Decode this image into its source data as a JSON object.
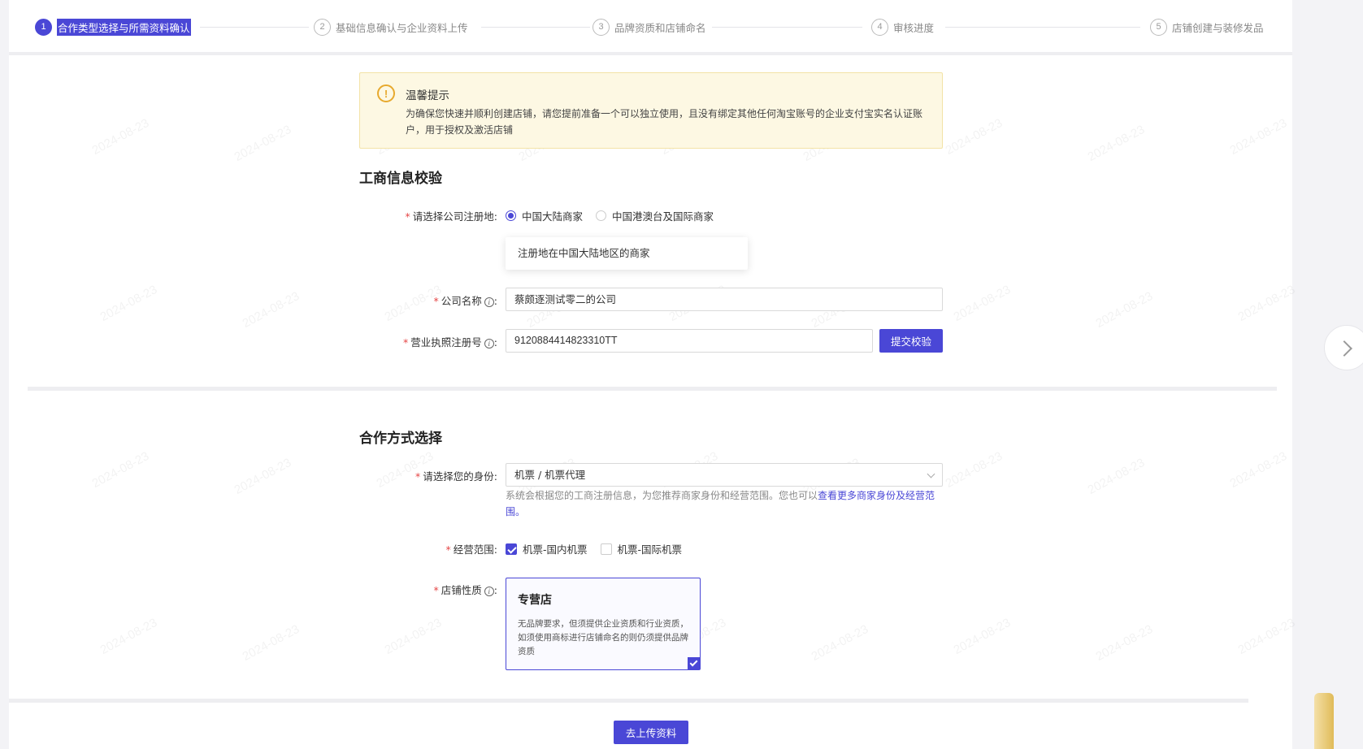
{
  "steps": [
    {
      "num": "1",
      "label": "合作类型选择与所需资料确认",
      "active": true
    },
    {
      "num": "2",
      "label": "基础信息确认与企业资料上传"
    },
    {
      "num": "3",
      "label": "品牌资质和店铺命名"
    },
    {
      "num": "4",
      "label": "审核进度"
    },
    {
      "num": "5",
      "label": "店铺创建与装修发品"
    }
  ],
  "notice": {
    "icon": "warning-icon",
    "title": "温馨提示",
    "text": "为确保您快速并顺利创建店铺，请您提前准备一个可以独立使用，且没有绑定其他任何淘宝账号的企业支付宝实名认证账户，用于授权及激活店铺"
  },
  "business_check": {
    "title": "工商信息校验",
    "region_label": "请选择公司注册地:",
    "region_options": [
      "中国大陆商家",
      "中国港澳台及国际商家"
    ],
    "region_selected": "中国大陆商家",
    "region_tooltip": "注册地在中国大陆地区的商家",
    "company_label": "公司名称",
    "company_value": "蔡颇逐测试零二的公司",
    "license_label": "营业执照注册号",
    "license_value": "9120884414823310TT",
    "submit_label": "提交校验"
  },
  "cooperation": {
    "title": "合作方式选择",
    "identity_label": "请选择您的身份:",
    "identity_value": "机票 / 机票代理",
    "help_text": "系统会根据您的工商注册信息，为您推荐商家身份和经营范围。您也可以",
    "help_link": "查看更多商家身份及经营范围",
    "help_end": "。",
    "scope_label": "经营范围:",
    "scope_options": [
      {
        "label": "机票-国内机票",
        "checked": true
      },
      {
        "label": "机票-国际机票",
        "checked": false
      }
    ],
    "shop_type_label": "店铺性质",
    "shop_card": {
      "title": "专营店",
      "desc": "无品牌要求，但须提供企业资质和行业资质，如须使用商标进行店铺命名的则仍须提供品牌资质"
    }
  },
  "footer": {
    "upload_label": "去上传资料"
  },
  "watermark": "2024-08-23",
  "colors": {
    "accent": "#4a47d6",
    "required": "#e54545",
    "notice_bg": "#fdf8e3"
  }
}
